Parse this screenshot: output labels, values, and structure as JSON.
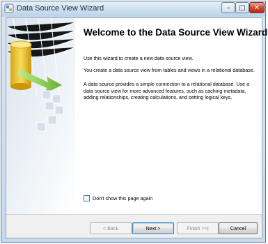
{
  "window": {
    "title": "Data Source View Wizard",
    "controls": {
      "minimize": "–",
      "maximize": "□",
      "close": "✕"
    }
  },
  "page": {
    "heading": "Welcome to the Data Source View Wizard",
    "paragraphs": [
      "Use this wizard to create a new data source view.",
      "You create a data source view from tables and views in a relational database.",
      "A data source provides a simple connection to a relational database. Use a data source view for more advanced features, such as caching metadata, adding relationships, creating calculations, and setting logical keys."
    ],
    "checkbox": {
      "label": "Don't show this page again",
      "checked": false
    }
  },
  "buttons": {
    "back": "< Back",
    "next": "Next >",
    "finish": "Finish >>|",
    "cancel": "Cancel"
  },
  "colors": {
    "title_bar": "#cddff0",
    "close_button": "#c9452b",
    "banner_cylinder": "#f0cc2e",
    "banner_arrow": "#7ec83c"
  }
}
